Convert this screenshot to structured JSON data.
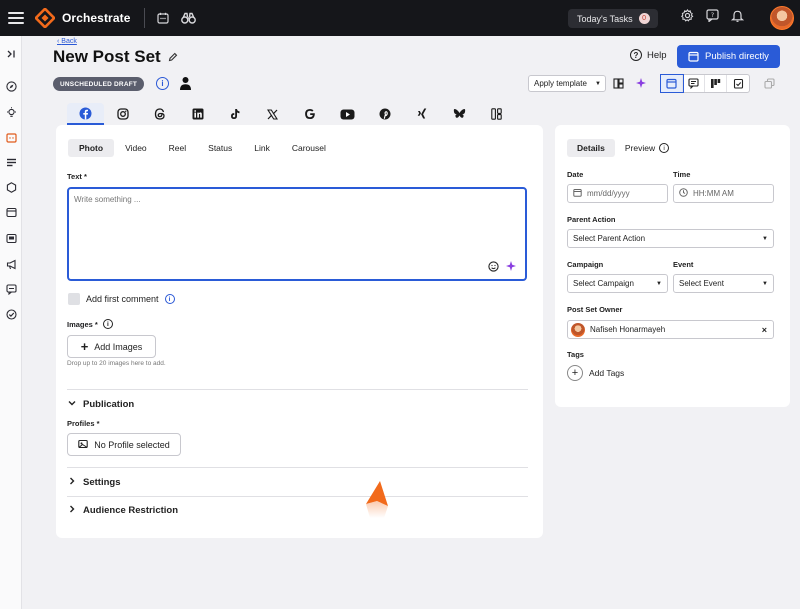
{
  "app": {
    "name": "Orchestrate",
    "tasks_label": "Today's Tasks",
    "tasks_count": "0"
  },
  "header": {
    "back_label": "Back",
    "title": "New Post Set",
    "status_badge": "UNSCHEDULED DRAFT",
    "help_label": "Help",
    "publish_label": "Publish directly",
    "template_label": "Apply template"
  },
  "social_tabs": [
    "facebook",
    "instagram",
    "threads",
    "linkedin",
    "tiktok",
    "x",
    "google",
    "youtube",
    "pinterest",
    "xing",
    "bluesky",
    "other"
  ],
  "post_types": [
    "Photo",
    "Video",
    "Reel",
    "Status",
    "Link",
    "Carousel"
  ],
  "form": {
    "text_label": "Text *",
    "text_placeholder": "Write something ...",
    "first_comment_label": "Add first comment",
    "images_label": "Images *",
    "add_images_label": "Add Images",
    "images_hint": "Drop up to 20 images here to add.",
    "publication_label": "Publication",
    "profiles_label": "Profiles *",
    "no_profile_label": "No Profile selected",
    "settings_label": "Settings",
    "audience_label": "Audience Restriction"
  },
  "details": {
    "tab_details": "Details",
    "tab_preview": "Preview",
    "date_label": "Date",
    "date_placeholder": "mm/dd/yyyy",
    "time_label": "Time",
    "time_placeholder": "HH:MM AM",
    "parent_action_label": "Parent Action",
    "parent_action_value": "Select Parent Action",
    "campaign_label": "Campaign",
    "campaign_value": "Select Campaign",
    "event_label": "Event",
    "event_value": "Select Event",
    "owner_label": "Post Set Owner",
    "owner_name": "Nafiseh Honarmayeh",
    "tags_label": "Tags",
    "add_tags_label": "Add Tags"
  },
  "colors": {
    "accent": "#2a5bd7",
    "brand_orange": "#f26a1b",
    "topbar": "#15161a"
  }
}
